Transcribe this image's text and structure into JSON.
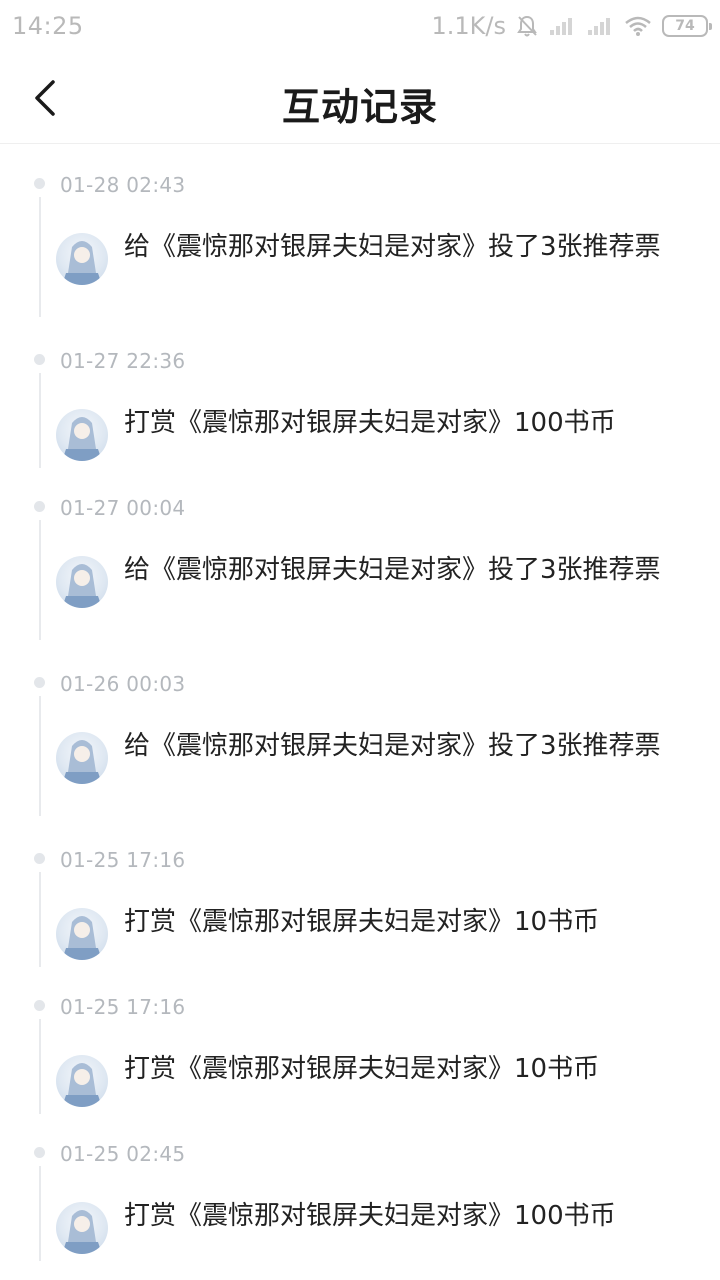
{
  "status_bar": {
    "time": "14:25",
    "net_speed": "1.1K/s",
    "battery": "74"
  },
  "header": {
    "title": "互动记录",
    "back_icon": "chevron-left-icon"
  },
  "records": [
    {
      "time": "01-28 02:43",
      "text": "给《震惊那对银屏夫妇是对家》投了3张推荐票"
    },
    {
      "time": "01-27 22:36",
      "text": "打赏《震惊那对银屏夫妇是对家》100书币"
    },
    {
      "time": "01-27 00:04",
      "text": "给《震惊那对银屏夫妇是对家》投了3张推荐票"
    },
    {
      "time": "01-26 00:03",
      "text": "给《震惊那对银屏夫妇是对家》投了3张推荐票"
    },
    {
      "time": "01-25 17:16",
      "text": "打赏《震惊那对银屏夫妇是对家》10书币"
    },
    {
      "time": "01-25 17:16",
      "text": "打赏《震惊那对银屏夫妇是对家》10书币"
    },
    {
      "time": "01-25 02:45",
      "text": "打赏《震惊那对银屏夫妇是对家》100书币"
    }
  ],
  "colors": {
    "title": "#1a1a1a",
    "text": "#222222",
    "time": "#b4b8bd",
    "timeline_dot": "#e3e6ea"
  }
}
